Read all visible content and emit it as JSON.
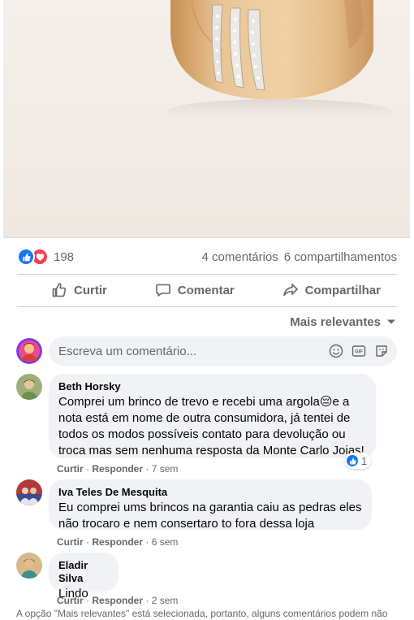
{
  "post": {
    "image_alt": "gold ring with diamond bands",
    "reaction_icons": [
      "like-icon",
      "love-icon"
    ],
    "reaction_count": "198",
    "comments_count": "4 comentários",
    "shares_count": "6 compartilhamentos"
  },
  "actions": {
    "like_label": "Curtir",
    "comment_label": "Comentar",
    "share_label": "Compartilhar"
  },
  "sort": {
    "label": "Mais relevantes"
  },
  "composer": {
    "placeholder": "Escreva um comentário..."
  },
  "comments": [
    {
      "author": "Beth Horsky",
      "text": "Comprei um brinco de trevo e recebi uma argola😔e a\nnota está em nome de outra consumidora, já tentei de\ntodos os modos possíveis contato para devolução ou\ntroca mas sem nenhuma resposta da Monte Carlo Joias!",
      "like": "Curtir",
      "reply": "Responder",
      "time": "7 sem",
      "reaction_count": "1"
    },
    {
      "author": "Iva Teles De Mesquita",
      "text": "Eu comprei ums brincos na garantia caiu as pedras eles\nnão trocaro e nem consertaro to fora dessa loja",
      "like": "Curtir",
      "reply": "Responder",
      "time": "6 sem"
    },
    {
      "author": "Eladir Silva",
      "text": "Lindo",
      "like": "Curtir",
      "reply": "Responder",
      "time": "2 sem"
    }
  ],
  "footer": {
    "note": "A opção \"Mais relevantes\" está selecionada, portanto, alguns comentários podem não"
  },
  "colors": {
    "facebook_blue": "#1877f2",
    "love_red": "#f33e58",
    "bubble_gray": "#f0f2f5",
    "secondary_text": "#65676b",
    "ring_gold": "#e3bd8b"
  }
}
